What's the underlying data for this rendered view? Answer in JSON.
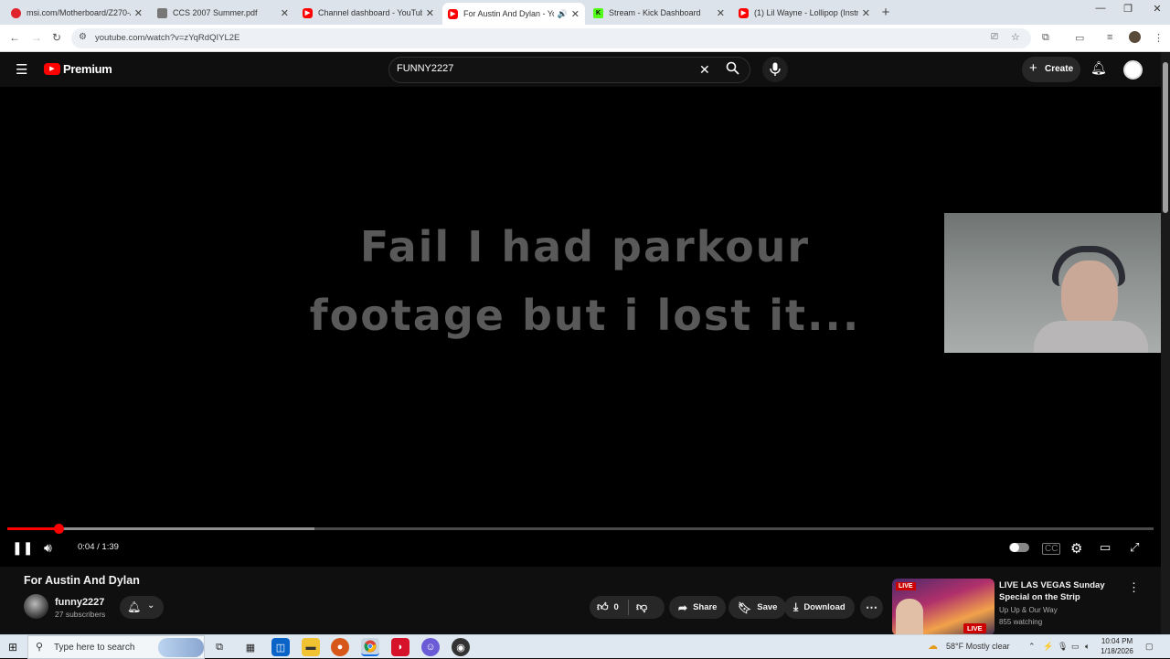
{
  "browser": {
    "tabs": [
      {
        "title": "msi.com/Motherboard/Z270-A",
        "icon": "msi-favicon",
        "color": "#e0242b"
      },
      {
        "title": "CCS 2007 Summer.pdf",
        "icon": "pdf-favicon",
        "color": "#555555"
      },
      {
        "title": "Channel dashboard - YouTube",
        "icon": "youtube-favicon",
        "color": "#ff0000"
      },
      {
        "title": "For Austin And Dylan - YouT",
        "icon": "youtube-favicon",
        "color": "#ff0000",
        "active": true,
        "playing": true
      },
      {
        "title": "Stream - Kick Dashboard",
        "icon": "kick-favicon",
        "color": "#53fc18"
      },
      {
        "title": "(1) Lil Wayne - Lollipop (Instru",
        "icon": "youtube-favicon",
        "color": "#ff0000"
      }
    ],
    "url": "youtube.com/watch?v=zYqRdQIYL2E"
  },
  "youtube": {
    "brand": "Premium",
    "search_value": "FUNNY2227",
    "create_label": "Create",
    "video": {
      "overlay_line1": "Fail I had parkour",
      "overlay_line2": "footage but i lost it...",
      "time_display": "0:04 / 1:39",
      "played_fraction": 0.045,
      "buffered_fraction": 0.268,
      "title": "For Austin And Dylan"
    },
    "channel": {
      "name": "funny2227",
      "subscribers": "27 subscribers"
    },
    "actions": {
      "likes": "0",
      "share": "Share",
      "save": "Save",
      "download": "Download"
    },
    "recommended": {
      "title": "LIVE LAS VEGAS Sunday Special on the Strip",
      "channel": "Up Up & Our Way",
      "watching": "855 watching",
      "live_badge": "LIVE"
    }
  },
  "taskbar": {
    "search_placeholder": "Type here to search",
    "weather": "58°F  Mostly clear",
    "time": "10:04 PM",
    "date": "1/18/2026"
  }
}
